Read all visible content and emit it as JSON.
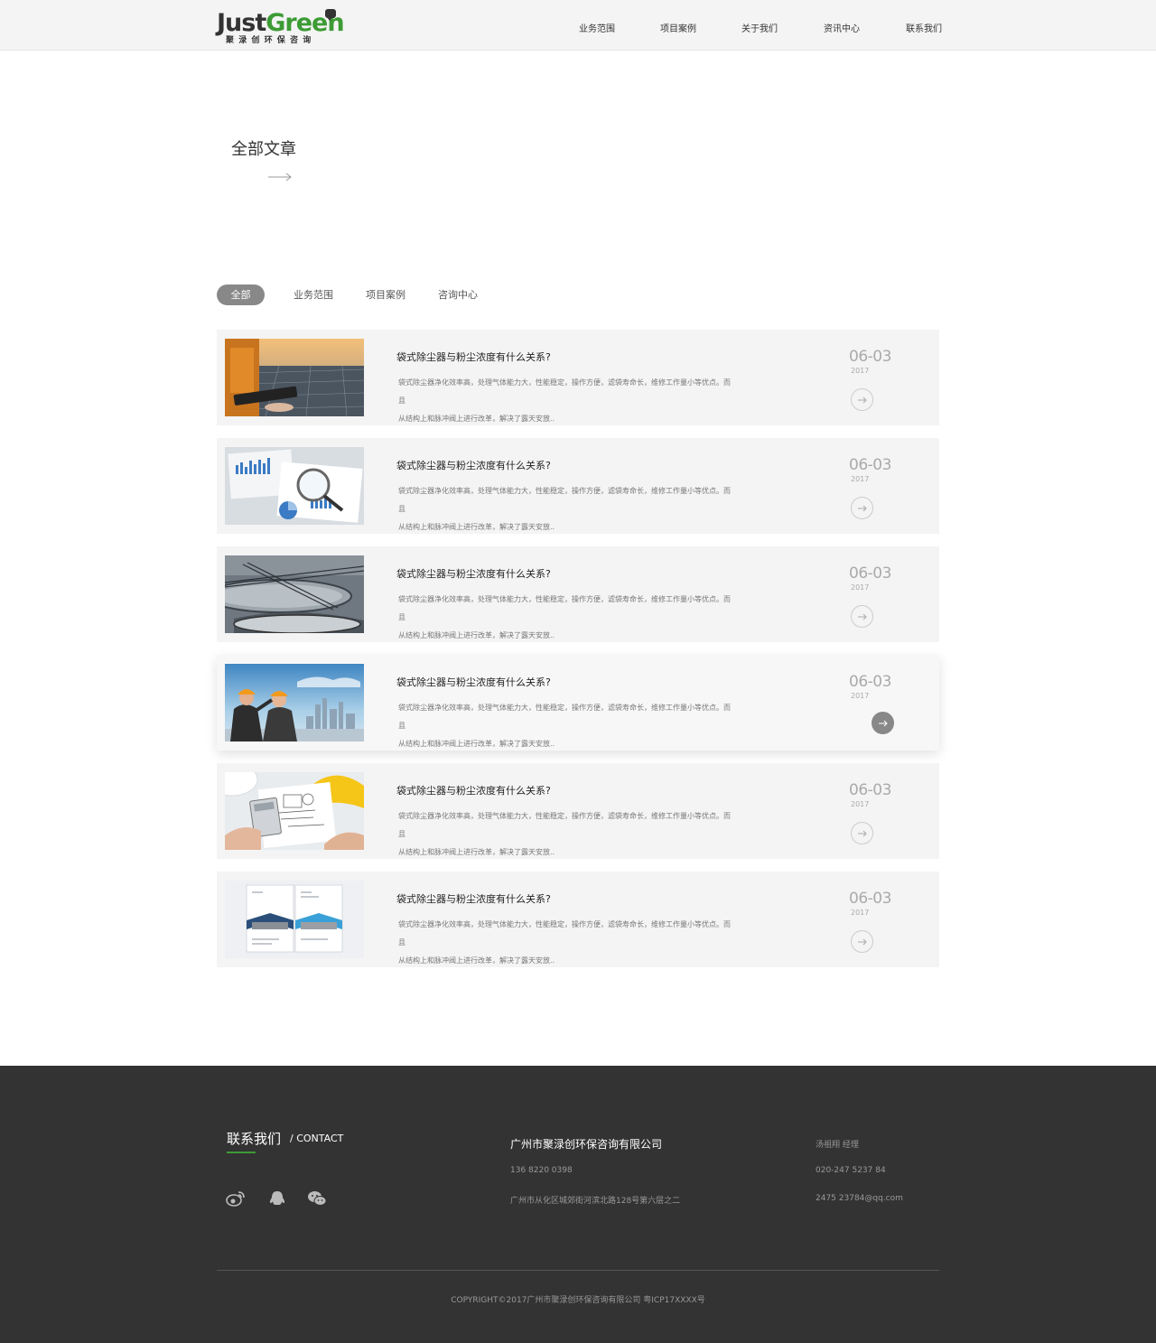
{
  "header": {
    "logo_just": "Just",
    "logo_green": "Green",
    "logo_sub": "聚渌创环保咨询",
    "nav": [
      {
        "label": "业务范围"
      },
      {
        "label": "项目案例"
      },
      {
        "label": "关于我们"
      },
      {
        "label": "资讯中心"
      },
      {
        "label": "联系我们"
      }
    ]
  },
  "hero": {
    "title": "全部文章"
  },
  "filters": [
    {
      "label": "全部",
      "active": true
    },
    {
      "label": "业务范围",
      "active": false
    },
    {
      "label": "项目案例",
      "active": false
    },
    {
      "label": "咨询中心",
      "active": false
    }
  ],
  "articles": [
    {
      "image": "solar-panel-worker-photo",
      "title": "袋式除尘器与粉尘浓度有什么关系?",
      "desc1": "袋式除尘器净化效率高，处理气体能力大，性能稳定，操作方便，滤袋寿命长，维修工作量小等优点。而且",
      "desc2": "从结构上和脉冲阀上进行改革，解决了露天安放..",
      "date": "06-03",
      "year": "2017"
    },
    {
      "image": "financial-charts-magnifier-photo",
      "title": "袋式除尘器与粉尘浓度有什么关系?",
      "desc1": "袋式除尘器净化效率高，处理气体能力大，性能稳定，操作方便，滤袋寿命长，维修工作量小等优点。而且",
      "desc2": "从结构上和脉冲阀上进行改革，解决了露天安放..",
      "date": "06-03",
      "year": "2017"
    },
    {
      "image": "water-treatment-tank-photo",
      "title": "袋式除尘器与粉尘浓度有什么关系?",
      "desc1": "袋式除尘器净化效率高，处理气体能力大，性能稳定，操作方便，滤袋寿命长，维修工作量小等优点。而且",
      "desc2": "从结构上和脉冲阀上进行改革，解决了露天安放..",
      "date": "06-03",
      "year": "2017"
    },
    {
      "image": "engineers-hardhat-city-photo",
      "title": "袋式除尘器与粉尘浓度有什么关系?",
      "desc1": "袋式除尘器净化效率高，处理气体能力大，性能稳定，操作方便，滤袋寿命长，维修工作量小等优点。而且",
      "desc2": "从结构上和脉冲阀上进行改革，解决了露天安放..",
      "date": "06-03",
      "year": "2017",
      "hover": true
    },
    {
      "image": "blueprint-calculator-helmet-photo",
      "title": "袋式除尘器与粉尘浓度有什么关系?",
      "desc1": "袋式除尘器净化效率高，处理气体能力大，性能稳定，操作方便，滤袋寿命长，维修工作量小等优点。而且",
      "desc2": "从结构上和脉冲阀上进行改革，解决了露天安放..",
      "date": "06-03",
      "year": "2017"
    },
    {
      "image": "brochure-layout-photo",
      "title": "袋式除尘器与粉尘浓度有什么关系?",
      "desc1": "袋式除尘器净化效率高，处理气体能力大，性能稳定，操作方便，滤袋寿命长，维修工作量小等优点。而且",
      "desc2": "从结构上和脉冲阀上进行改革，解决了露天安放..",
      "date": "06-03",
      "year": "2017"
    }
  ],
  "footer": {
    "contact_title": "联系我们",
    "contact_sub": "/ CONTACT",
    "social_icons": [
      "weibo-icon",
      "qq-icon",
      "wechat-icon"
    ],
    "company": "广州市聚渌创环保咨询有限公司",
    "phone": "136 8220 0398",
    "address": "广州市从化区城郊街河滨北路128号第六层之二",
    "person": "汤祖翔 经理",
    "tel": "020-247 5237 84",
    "email": "2475 23784@qq.com",
    "copyright": "COPYRIGHT©2017广州市聚渌创环保咨询有限公司 粤ICP17XXXX号"
  },
  "colors": {
    "brand_green": "#3d9b35",
    "footer_bg": "#333333",
    "card_bg": "#f4f4f4",
    "active_tab": "#888888"
  }
}
